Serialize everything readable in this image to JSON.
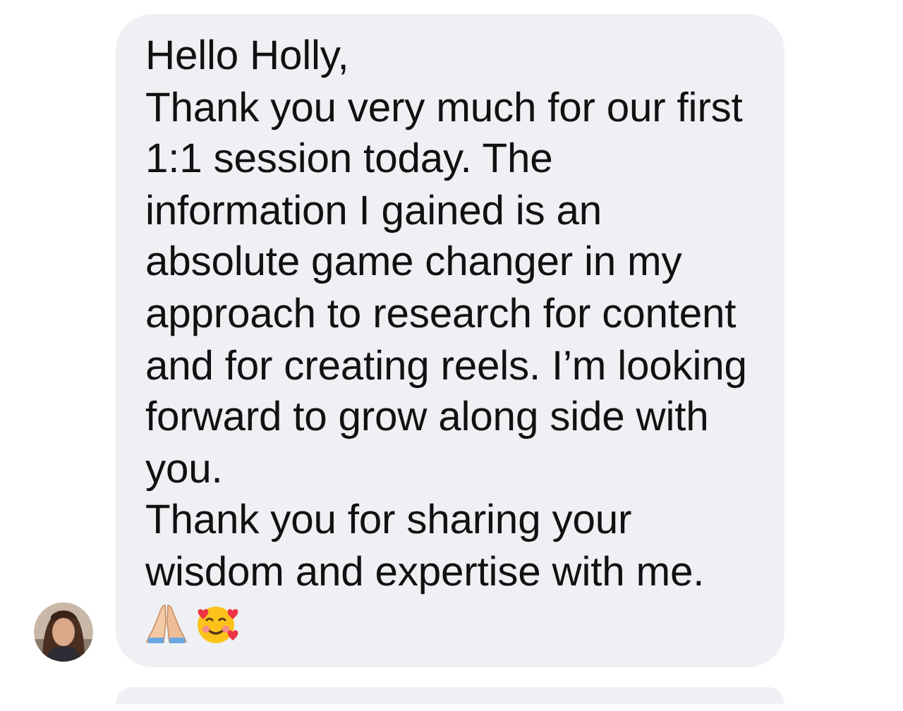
{
  "messages": [
    {
      "paragraphs": [
        "Hello Holly,",
        "Thank you very much for our first 1:1 session today. The information I gained is an absolute game changer in my approach to research for content and for creating reels. I’m looking forward to grow along side with you.",
        "Thank you for sharing your wisdom and expertise with me."
      ]
    }
  ]
}
